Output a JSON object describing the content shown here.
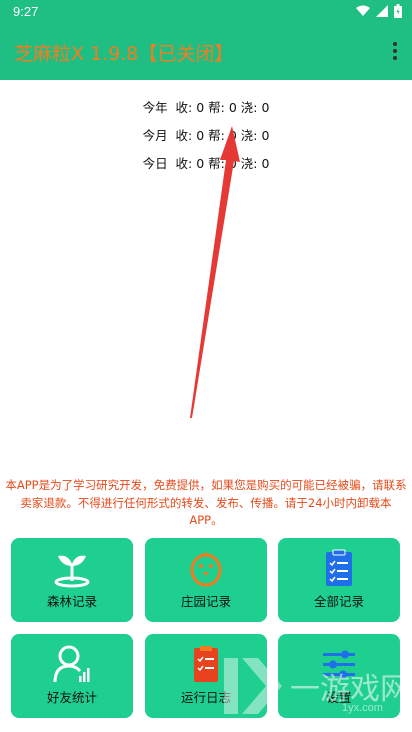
{
  "status_bar": {
    "time": "9:27"
  },
  "app_bar": {
    "title": "芝麻粒X 1.9.8【已关闭】",
    "menu_icon": "more-vert-icon"
  },
  "stats": [
    {
      "label": "今年",
      "text": "收: 0 帮: 0 浇: 0"
    },
    {
      "label": "今月",
      "text": "收: 0 帮: 0 浇: 0"
    },
    {
      "label": "今日",
      "text": "收: 0 帮: 0 浇: 0"
    }
  ],
  "disclaimer": "本APP是为了学习研究开发，免费提供，如果您是购买的可能已经被骗，请联系卖家退款。不得进行任何形式的转发、发布、传播。请于24小时内卸载本APP。",
  "tiles": [
    {
      "label": "森林记录",
      "icon": "sprout-icon"
    },
    {
      "label": "庄园记录",
      "icon": "chick-icon"
    },
    {
      "label": "全部记录",
      "icon": "clipboard-list-icon"
    },
    {
      "label": "好友统计",
      "icon": "user-stats-icon"
    },
    {
      "label": "运行日志",
      "icon": "log-book-icon"
    },
    {
      "label": "设置",
      "icon": "settings-sliders-icon"
    }
  ],
  "watermark": {
    "text": "一游戏网",
    "sub": "1yx.com"
  },
  "colors": {
    "primary": "#1fbf84",
    "tile": "#1fcf8f",
    "title": "#f47b20",
    "disclaimer": "#e64a19",
    "arrow": "#e53935"
  }
}
